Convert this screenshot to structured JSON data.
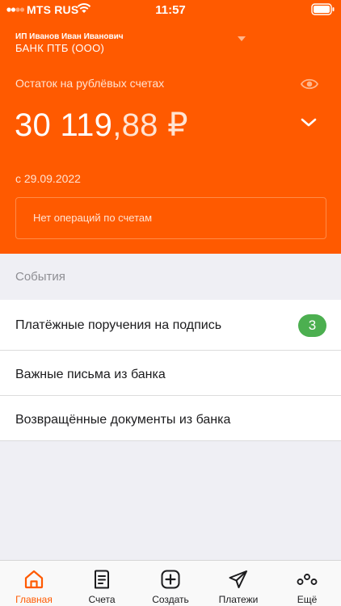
{
  "status_bar": {
    "carrier": "MTS RUS",
    "time": "11:57"
  },
  "account": {
    "company": "ИП Иванов Иван Иванович",
    "bank": "БАНК ПТБ (ООО)"
  },
  "balance": {
    "label": "Остаток на рублёвых счетах",
    "integer": "30 119",
    "decimals": ",88 ₽",
    "since": "с 29.09.2022",
    "no_operations": "Нет операций по счетам"
  },
  "events": {
    "label": "События",
    "items": [
      {
        "label": "Платёжные поручения на подпись",
        "badge": "3"
      },
      {
        "label": "Важные письма из банка"
      },
      {
        "label": "Возвращённые документы из банка"
      }
    ]
  },
  "tabbar": {
    "items": [
      {
        "label": "Главная",
        "icon": "home-icon",
        "active": true
      },
      {
        "label": "Счета",
        "icon": "document-icon"
      },
      {
        "label": "Создать",
        "icon": "plus-square-icon"
      },
      {
        "label": "Платежи",
        "icon": "paper-plane-icon"
      },
      {
        "label": "Ещё",
        "icon": "more-dots-icon"
      }
    ]
  },
  "colors": {
    "brand": "#ff5a00",
    "badge": "#4caf50",
    "background": "#efeff4"
  }
}
